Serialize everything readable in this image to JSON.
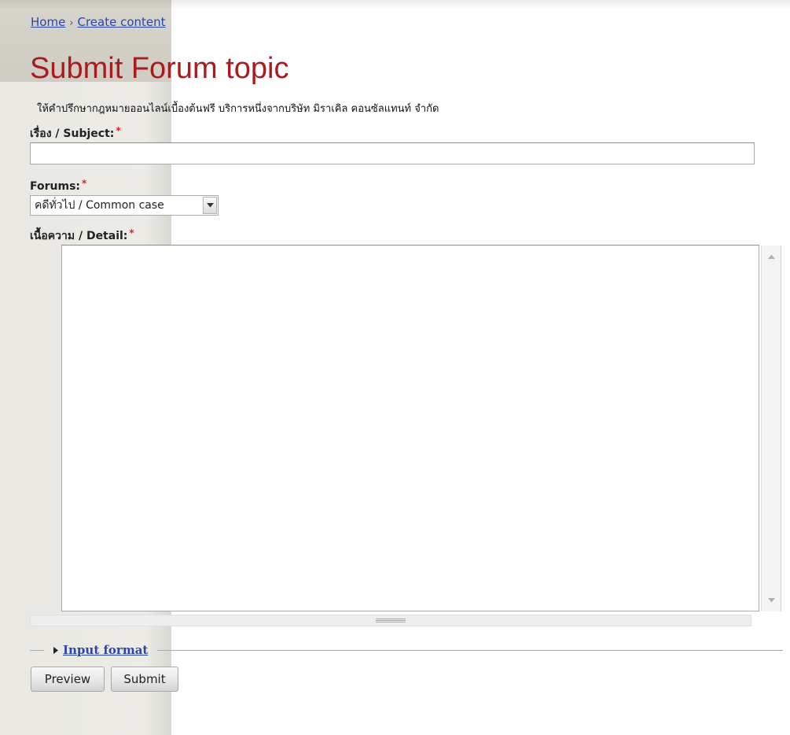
{
  "breadcrumb": {
    "home": "Home",
    "separator": "›",
    "create_content": "Create content"
  },
  "page_title": "Submit Forum topic",
  "intro_text": "ให้คำปรึกษากฎหมายออนไลน์เบื้องต้นฟรี บริการหนึ่งจากบริษัท มิราเคิล คอนซัลแทนท์ จำกัด",
  "form": {
    "subject": {
      "label": "เรื่อง / Subject:",
      "required_mark": "*",
      "value": ""
    },
    "forums": {
      "label": "Forums:",
      "required_mark": "*",
      "selected": "คดีทั่วไป / Common case"
    },
    "detail": {
      "label": "เนื้อความ / Detail:",
      "required_mark": "*",
      "value": ""
    },
    "input_format_label": "Input format",
    "buttons": {
      "preview": "Preview",
      "submit": "Submit"
    }
  },
  "colors": {
    "title": "#a81b1e",
    "link": "#2a46b0",
    "required": "#dd2222",
    "sidebar": "#e9e8e2"
  }
}
